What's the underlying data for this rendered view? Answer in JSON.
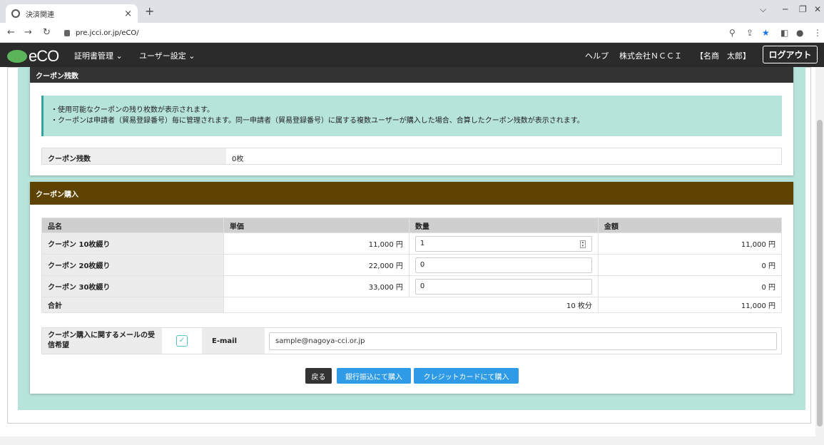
{
  "browser": {
    "tab_title": "決済関連",
    "tab_close": "×",
    "new_tab": "+",
    "url": "pre.jcci.or.jp/eCO/",
    "minimize": "─",
    "maximize": "❐",
    "close": "✕",
    "dropdown": "⌵"
  },
  "header": {
    "logo_text": "eCO",
    "menu_certificates": "証明書管理 ⌄",
    "menu_user": "ユーザー設定 ⌄",
    "help": "ヘルプ",
    "company": "株式会社ＮＣＣＩ",
    "user": "【名商　太郎】",
    "logout": "ログアウト"
  },
  "balance_section": {
    "title": "クーポン残数",
    "notice_line1": "・使用可能なクーポンの残り枚数が表示されます。",
    "notice_line2": "・クーポンは申請者（貿易登録番号）毎に管理されます。同一申請者（貿易登録番号）に属する複数ユーザーが購入した場合、合算したクーポン残数が表示されます。",
    "label": "クーポン残数",
    "value": "0枚"
  },
  "purchase_section": {
    "title": "クーポン購入",
    "columns": [
      "品名",
      "単価",
      "数量",
      "金額"
    ],
    "rows": [
      {
        "name": "クーポン 10枚綴り",
        "unit_price": "11,000 円",
        "quantity": "1",
        "amount": "11,000 円"
      },
      {
        "name": "クーポン 20枚綴り",
        "unit_price": "22,000 円",
        "quantity": "0",
        "amount": "0 円"
      },
      {
        "name": "クーポン 30枚綴り",
        "unit_price": "33,000 円",
        "quantity": "0",
        "amount": "0 円"
      }
    ],
    "total_label": "合計",
    "total_count": "10 枚分",
    "total_amount": "11,000 円",
    "mail_label": "クーポン購入に関するメールの受信希望",
    "mail_checked": true,
    "email_label": "E-mail",
    "email_value": "sample@nagoya-cci.or.jp"
  },
  "buttons": {
    "back": "戻る",
    "bank": "銀行振込にて購入",
    "credit": "クレジットカードにて購入"
  },
  "colors": {
    "balance_header": "#333333",
    "purchase_header": "#5e4300",
    "teal_bg": "#b6e3da",
    "button_blue": "#2f9be6"
  }
}
